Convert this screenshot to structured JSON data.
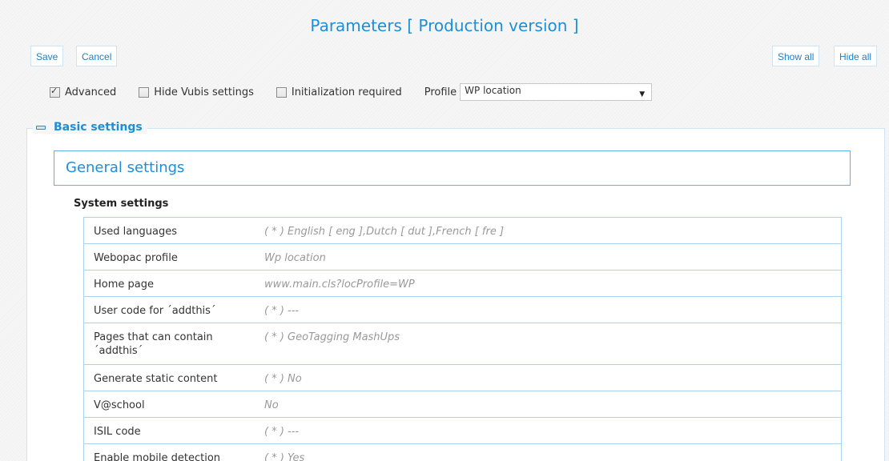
{
  "page_title": "Parameters [ Production version ]",
  "toolbar": {
    "save": "Save",
    "cancel": "Cancel",
    "show_all": "Show all",
    "hide_all": "Hide all"
  },
  "options": {
    "advanced": {
      "label": "Advanced",
      "checked": true
    },
    "hide_vubis": {
      "label": "Hide Vubis settings",
      "checked": false
    },
    "init_required": {
      "label": "Initialization required",
      "checked": false
    },
    "profile_label": "Profile",
    "profile_value": "WP location"
  },
  "basic_settings": {
    "legend": "Basic settings",
    "general_settings": "General settings",
    "system_settings_title": "System settings",
    "rows": [
      {
        "label": "Used languages",
        "value": "( * ) English [ eng ],Dutch [ dut ],French [ fre ]"
      },
      {
        "label": "Webopac profile",
        "value": "Wp location"
      },
      {
        "label": "Home page",
        "value": "www.main.cls?locProfile=WP"
      },
      {
        "label": "User code for ´addthis´",
        "value": "( * ) ---"
      },
      {
        "label": "Pages that can contain ´addthis´",
        "value": "( * ) GeoTagging MashUps"
      },
      {
        "label": "Generate static content",
        "value": "( * ) No"
      },
      {
        "label": "V@school",
        "value": "No"
      },
      {
        "label": "ISIL code",
        "value": "( * ) ---"
      },
      {
        "label": "Enable mobile detection",
        "value": "( * ) Yes"
      }
    ]
  }
}
